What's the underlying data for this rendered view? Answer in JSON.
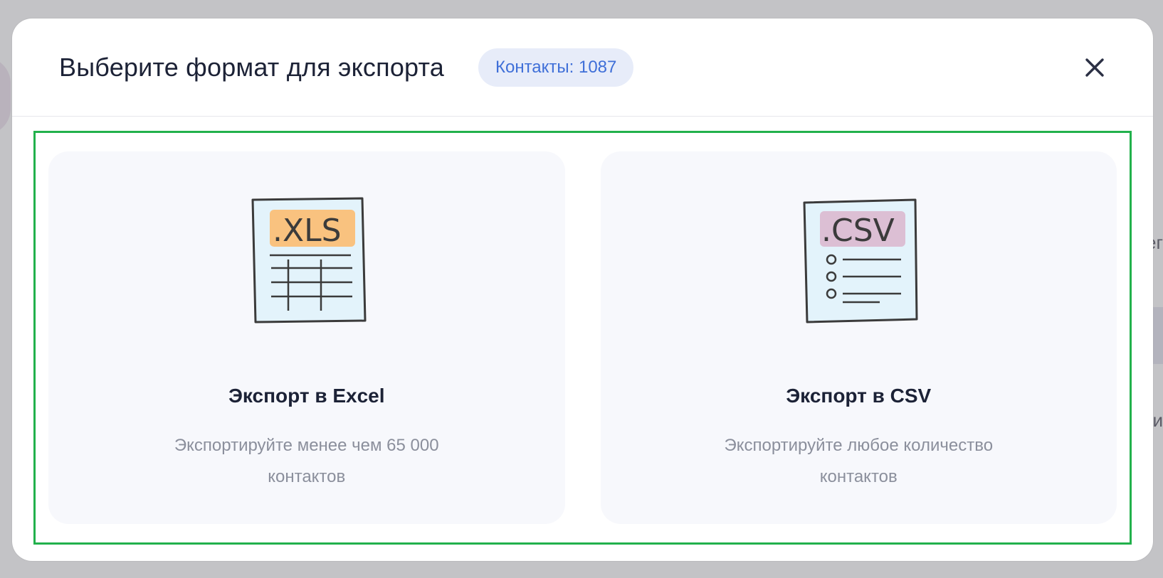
{
  "modal": {
    "title": "Выберите формат для экспорта",
    "contacts_badge": "Контакты: 1087"
  },
  "options": [
    {
      "file_label": ".XLS",
      "title": "Экспорт в Excel",
      "description": "Экспортируйте менее чем 65 000\nконтактов",
      "icon": "xls-file-icon",
      "label_color": "#f9c27f"
    },
    {
      "file_label": ".CSV",
      "title": "Экспорт в CSV",
      "description": "Экспортируйте любое количество\nконтактов",
      "icon": "csv-file-icon",
      "label_color": "#dcbfd4"
    }
  ],
  "colors": {
    "accent_badge_text": "#3f6fd8",
    "badge_bg": "#e7ecf9",
    "highlight_border": "#22b14c",
    "card_bg": "#f7f8fc"
  },
  "background": {
    "right_text_1": "ег",
    "right_text_2": "и"
  }
}
